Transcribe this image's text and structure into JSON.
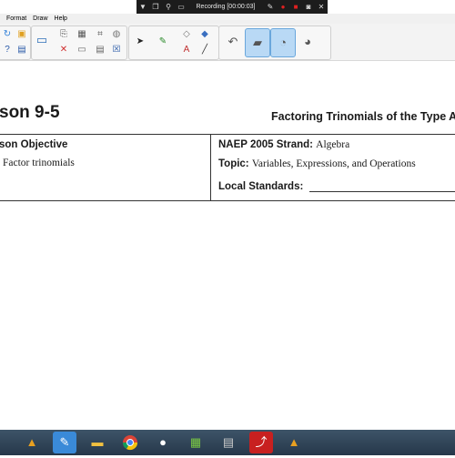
{
  "recording_bar": {
    "title": "Recording [00:00:03]",
    "icons": [
      "dropdown-icon",
      "restore-icon",
      "search-icon",
      "desktop-icon",
      "pen-icon",
      "record-icon",
      "stop-icon",
      "camera-icon",
      "close-icon"
    ]
  },
  "menu": {
    "items": [
      "Format",
      "Draw",
      "Help"
    ]
  },
  "toolbar": {
    "tools": [
      "pointer-tool",
      "pen-tool",
      "eraser-tool",
      "highlighter-tool",
      "text-tool",
      "line-tool",
      "undo-tool",
      "page-tool"
    ]
  },
  "document": {
    "lesson_title": "son 9-5",
    "subtitle": "Factoring Trinomials of the Type A",
    "objective_heading": "son Objective",
    "objective_text": "Factor trinomials",
    "naep_label": "NAEP 2005 Strand:",
    "naep_value": "Algebra",
    "topic_label": "Topic:",
    "topic_value": "Variables, Expressions, and Operations",
    "local_label": "Local Standards:"
  },
  "taskbar": {
    "apps": [
      "app-icon-1",
      "notes-icon",
      "folder-icon",
      "chrome-icon",
      "media-icon",
      "grid-icon",
      "calculator-icon",
      "pdf-icon",
      "app-icon-2"
    ]
  }
}
